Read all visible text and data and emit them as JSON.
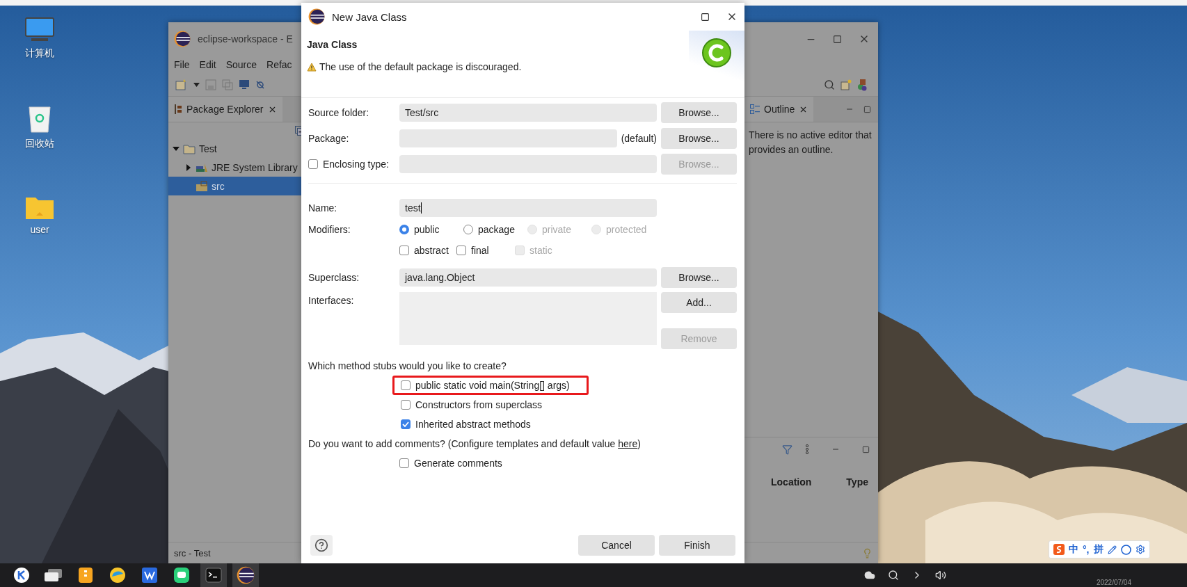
{
  "desktop": {
    "icons": [
      {
        "label": "计算机",
        "kind": "computer"
      },
      {
        "label": "回收站",
        "kind": "trash"
      },
      {
        "label": "user",
        "kind": "folder"
      }
    ]
  },
  "ide": {
    "title": "eclipse-workspace - E",
    "menu": [
      "File",
      "Edit",
      "Source",
      "Refac"
    ],
    "explorer": {
      "tab": "Package Explorer",
      "tree": [
        {
          "label": "Test",
          "kind": "project",
          "expanded": true,
          "selected": false,
          "children": [
            {
              "label": "JRE System Library",
              "kind": "library",
              "expanded": false,
              "selected": false
            },
            {
              "label": "src",
              "kind": "source",
              "selected": true
            }
          ]
        }
      ]
    },
    "outline": {
      "tab": "Outline",
      "message": "There is no active editor that provides an outline."
    },
    "bottom_panel": {
      "columns": [
        "Location",
        "Type"
      ]
    },
    "status": "src - Test"
  },
  "dialog": {
    "title": "New Java Class",
    "heading": "Java Class",
    "message": "The use of the default package is discouraged.",
    "source_folder": {
      "label": "Source folder:",
      "value": "Test/src",
      "button": "Browse..."
    },
    "package": {
      "label": "Package:",
      "suffix": "(default)",
      "button": "Browse..."
    },
    "enclosing_type": {
      "label": "Enclosing type:",
      "checked": false,
      "button": "Browse...",
      "button_disabled": true
    },
    "name": {
      "label": "Name:",
      "value": "test"
    },
    "modifiers": {
      "label": "Modifiers:",
      "access": [
        {
          "label": "public",
          "selected": true,
          "disabled": false
        },
        {
          "label": "package",
          "selected": false,
          "disabled": false
        },
        {
          "label": "private",
          "selected": false,
          "disabled": true
        },
        {
          "label": "protected",
          "selected": false,
          "disabled": true
        }
      ],
      "flags": [
        {
          "label": "abstract",
          "checked": false,
          "disabled": false
        },
        {
          "label": "final",
          "checked": false,
          "disabled": false
        },
        {
          "label": "static",
          "checked": false,
          "disabled": true
        }
      ]
    },
    "superclass": {
      "label": "Superclass:",
      "value": "java.lang.Object",
      "button": "Browse..."
    },
    "interfaces": {
      "label": "Interfaces:",
      "buttons": [
        {
          "label": "Add...",
          "disabled": false
        },
        {
          "label": "Remove",
          "disabled": true
        }
      ]
    },
    "stubs": {
      "question": "Which method stubs would you like to create?",
      "options": [
        {
          "label": "public static void main(String[] args)",
          "checked": false,
          "highlighted": true
        },
        {
          "label": "Constructors from superclass",
          "checked": false,
          "highlighted": false
        },
        {
          "label": "Inherited abstract methods",
          "checked": true,
          "highlighted": false
        }
      ]
    },
    "comments": {
      "question": "Do you want to add comments? (Configure templates and default value ",
      "link": "here",
      "question_end": ")",
      "option": {
        "label": "Generate comments",
        "checked": false
      }
    },
    "buttons": [
      "Cancel",
      "Finish"
    ]
  },
  "taskbar": {
    "apps": [
      {
        "kind": "launcher",
        "active": false
      },
      {
        "kind": "windows",
        "active": false
      },
      {
        "kind": "files",
        "active": false
      },
      {
        "kind": "browser",
        "active": false
      },
      {
        "kind": "office",
        "active": false
      },
      {
        "kind": "chat",
        "active": false
      },
      {
        "kind": "terminal",
        "active": true
      },
      {
        "kind": "eclipse",
        "active": true
      }
    ],
    "ime": [
      "中",
      "°,",
      "拼"
    ],
    "date": "2022/07/04"
  }
}
